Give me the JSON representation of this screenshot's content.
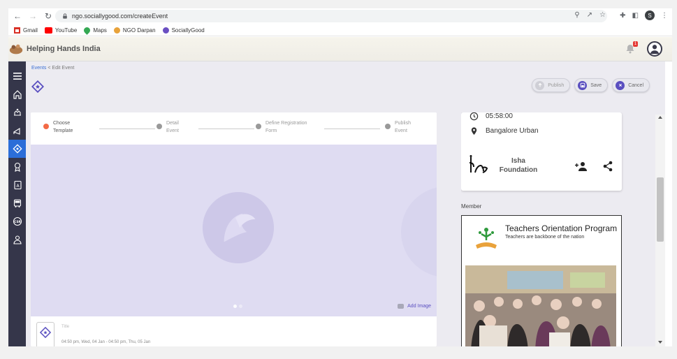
{
  "browser": {
    "url": "ngo.sociallygood.com/createEvent",
    "profile_initial": "S"
  },
  "bookmarks": [
    {
      "label": "Gmail",
      "icon": "gmail-icon",
      "color": "#d93025"
    },
    {
      "label": "YouTube",
      "icon": "youtube-icon",
      "color": "#ff0000"
    },
    {
      "label": "Maps",
      "icon": "maps-icon",
      "color": "#34a853"
    },
    {
      "label": "NGO Darpan",
      "icon": "ngo-darpan-icon",
      "color": "#e8a23a"
    },
    {
      "label": "SociallyGood",
      "icon": "sociallygood-icon",
      "color": "#6a4fc2"
    }
  ],
  "header": {
    "brand": "Helping Hands India",
    "notification_count": "1"
  },
  "breadcrumb": {
    "parent": "Events",
    "separator": "<",
    "current": "Edit Event"
  },
  "toolbar": {
    "publish_label": "Publish",
    "save_label": "Save",
    "cancel_label": "Cancel"
  },
  "stepper": {
    "steps": [
      {
        "line1": "Choose",
        "line2": "Template",
        "active": true
      },
      {
        "line1": "Detail",
        "line2": "Event",
        "active": false
      },
      {
        "line1": "Define Registration",
        "line2": "Form",
        "active": false
      },
      {
        "line1": "Publish",
        "line2": "Event",
        "active": false
      }
    ]
  },
  "image_area": {
    "add_image_label": "Add Image"
  },
  "event": {
    "title": "Title",
    "time": "04:50 pm, Wed, 04 Jan - 04:50 pm, Thu, 05 Jan"
  },
  "org_card": {
    "time": "05:58:00",
    "location": "Bangalore Urban",
    "org_name": "Isha Foundation"
  },
  "member": {
    "label": "Member",
    "poster_title": "Teachers Orientation Program",
    "poster_subtitle": "Teachers are backbone of the nation"
  },
  "colors": {
    "sidebar_bg": "#35364a",
    "sidebar_active": "#2b6ed8",
    "accent": "#5a4fc0",
    "step_active": "#f36a46",
    "image_area_bg": "#dfdcf2"
  }
}
